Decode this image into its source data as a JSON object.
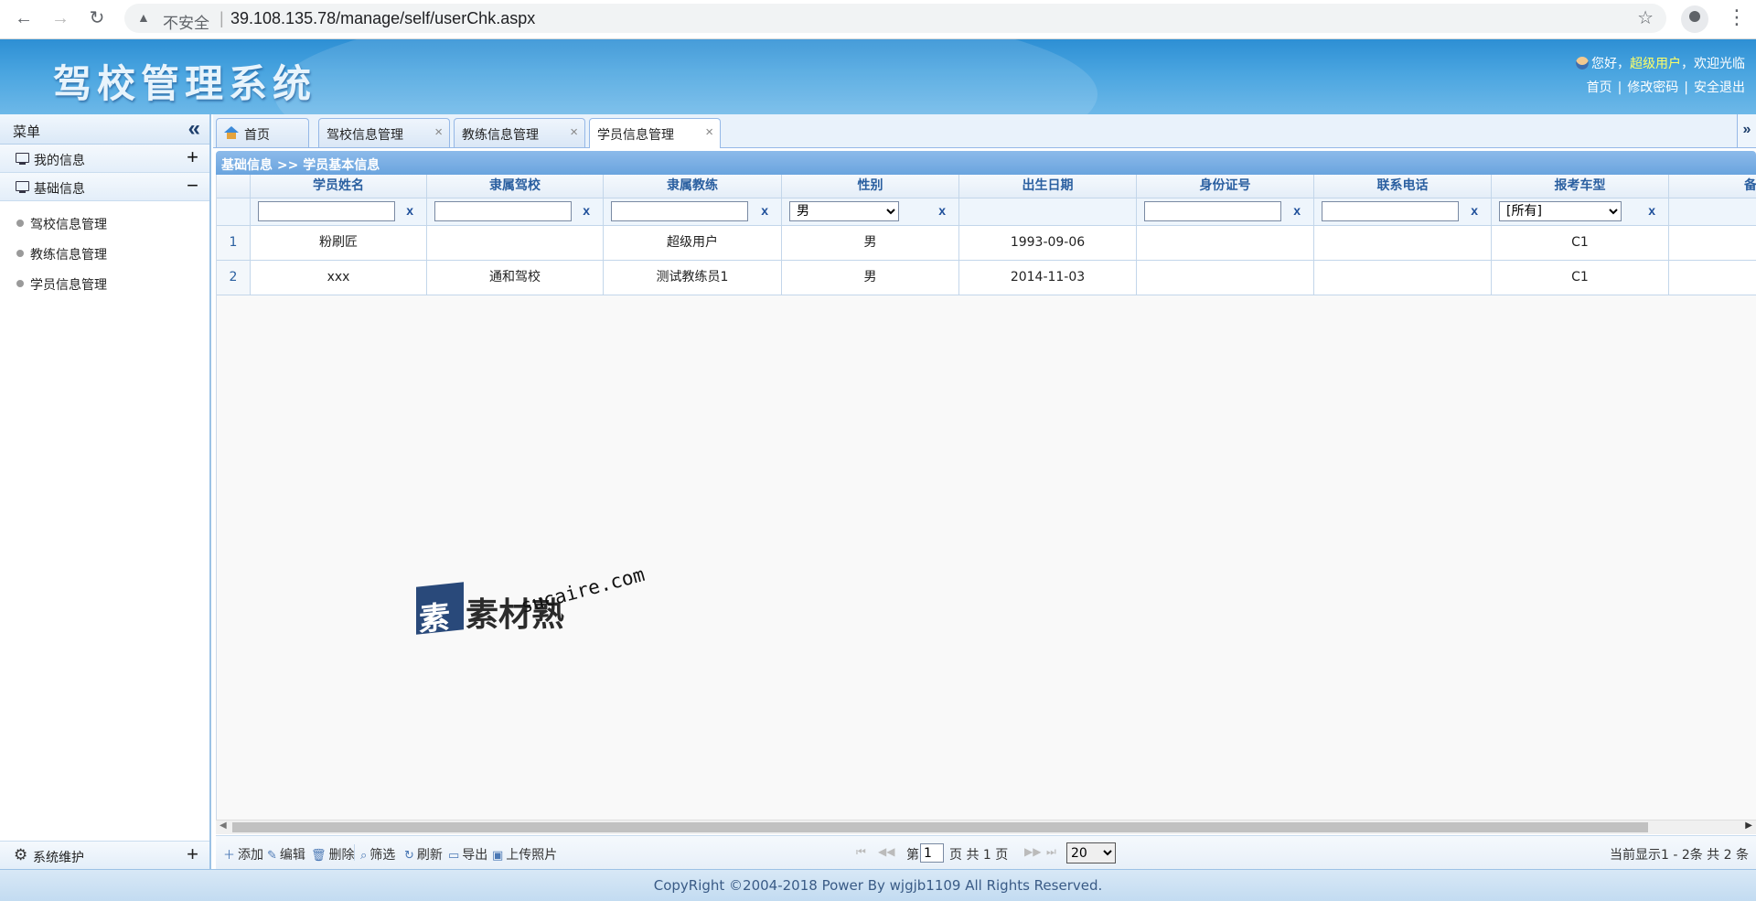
{
  "browser": {
    "insecure_label": "不安全",
    "url": "39.108.135.78/manage/self/userChk.aspx"
  },
  "header": {
    "system_title": "驾校管理系统",
    "greeting": "您好，",
    "username": "超级用户",
    "welcome": "，欢迎光临",
    "links": [
      "首页",
      "修改密码",
      "安全退出"
    ]
  },
  "sidebar": {
    "title": "菜单",
    "sections": [
      {
        "label": "我的信息",
        "toggle": "+"
      },
      {
        "label": "基础信息",
        "toggle": "−"
      }
    ],
    "items": [
      "驾校信息管理",
      "教练信息管理",
      "学员信息管理"
    ],
    "bottom_section": {
      "label": "系统维护",
      "toggle": "+"
    }
  },
  "tabs": [
    {
      "label": "首页"
    },
    {
      "label": "驾校信息管理"
    },
    {
      "label": "教练信息管理"
    },
    {
      "label": "学员信息管理"
    }
  ],
  "panel": {
    "title": "基础信息 >> 学员基本信息"
  },
  "grid": {
    "columns": [
      "学员姓名",
      "隶属驾校",
      "隶属教练",
      "性别",
      "出生日期",
      "身份证号",
      "联系电话",
      "报考车型",
      "备"
    ],
    "filters": {
      "gender_selected": "男",
      "car_type_selected": "[所有]",
      "clear_label": "x"
    },
    "rows": [
      {
        "no": "1",
        "name": "粉刷匠",
        "school": "",
        "coach": "超级用户",
        "gender": "男",
        "birth": "1993-09-06",
        "id": "",
        "phone": "",
        "car": "C1"
      },
      {
        "no": "2",
        "name": "xxx",
        "school": "通和驾校",
        "coach": "测试教练员1",
        "gender": "男",
        "birth": "2014-11-03",
        "id": "",
        "phone": "",
        "car": "C1"
      }
    ]
  },
  "watermark": {
    "cn": "素材熟",
    "badge": "素",
    "en": "sucaire.com"
  },
  "toolbar": {
    "buttons": [
      "添加",
      "编辑",
      "删除",
      "筛选",
      "刷新",
      "导出",
      "上传照片"
    ],
    "page_prefix": "第",
    "page_value": "1",
    "page_suffix": "页 共 1 页",
    "page_size": "20",
    "info": "当前显示1 - 2条   共 2 条"
  },
  "footer": {
    "text": "CopyRight ©2004-2018 Power By wjgjb1109    All Rights Reserved."
  }
}
